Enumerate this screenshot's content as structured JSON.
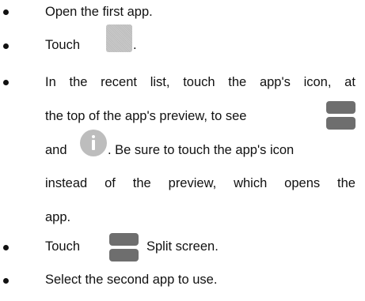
{
  "steps": [
    {
      "text": "Open the first app."
    },
    {
      "before": "Touch",
      "after": "."
    },
    {
      "lines": [
        [
          "In",
          "the",
          "recent",
          "list,",
          "touch",
          "the",
          "app's",
          "icon,",
          "at"
        ],
        [
          "the top of the app's preview, to see"
        ],
        [
          "and"
        ],
        [
          "instead",
          "of",
          "the",
          "preview,",
          "which",
          "opens",
          "the"
        ],
        [
          "app."
        ]
      ],
      "line3_after_icon": ". Be sure to touch the app's icon"
    },
    {
      "before": "Touch",
      "after": "Split screen."
    },
    {
      "text": "Select the second app to use."
    }
  ],
  "icons": {
    "recent": "recent-apps-icon",
    "split": "split-screen-icon",
    "info": "info-icon"
  },
  "colors": {
    "text": "#111111",
    "icon_gray": "#bdbdbd",
    "split_gray": "#6e6e6e"
  }
}
